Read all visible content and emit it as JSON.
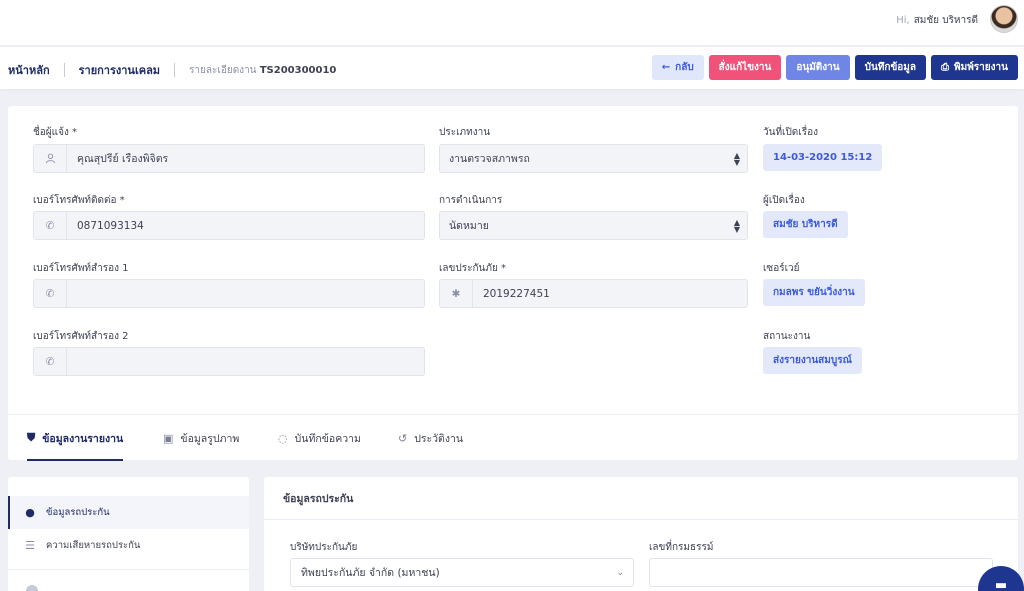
{
  "header": {
    "greeting_prefix": "Hi,",
    "user_name": "สมชัย บริหารดี"
  },
  "breadcrumb": {
    "home": "หน้าหลัก",
    "claims": "รายการงานเคลม",
    "detail_prefix": "รายละเอียดงาน",
    "job_id": "TS200300010"
  },
  "actions": {
    "back": "กลับ",
    "edit": "สั่งแก้ไขงาน",
    "approve": "อนุมัติงาน",
    "save": "บันทึกข้อมูล",
    "print": "พิมพ์รายงาน"
  },
  "form": {
    "reporter_label": "ชื่อผู้แจ้ง *",
    "reporter_value": "คุณสุปรีย์ เรืองพิจิตร",
    "phone_label": "เบอร์โทรศัพท์ติดต่อ *",
    "phone_value": "0871093134",
    "phone_alt1_label": "เบอร์โทรศัพท์สำรอง 1",
    "phone_alt1_value": "",
    "phone_alt2_label": "เบอร์โทรศัพท์สำรอง 2",
    "phone_alt2_value": "",
    "job_type_label": "ประเภทงาน",
    "job_type_value": "งานตรวจสภาพรถ",
    "process_label": "การดำเนินการ",
    "process_value": "นัดหมาย",
    "policy_label": "เลขประกันภัย *",
    "policy_value": "2019227451",
    "opened_date_label": "วันที่เปิดเรื่อง",
    "opened_date_value": "14-03-2020 15:12",
    "opened_by_label": "ผู้เปิดเรื่อง",
    "opened_by_value": "สมชัย บริหารดี",
    "surveyor_label": "เซอร์เวย์",
    "surveyor_value": "กมลพร ขยันวิ่งงาน",
    "status_label": "สถานะงาน",
    "status_value": "ส่งรายงานสมบูรณ์"
  },
  "tabs": [
    {
      "label": "ข้อมูลงานรายงาน",
      "icon": "shield-icon"
    },
    {
      "label": "ข้อมูลรูปภาพ",
      "icon": "image-icon"
    },
    {
      "label": "บันทึกข้อความ",
      "icon": "chat-icon"
    },
    {
      "label": "ประวัติงาน",
      "icon": "history-icon"
    }
  ],
  "sidebar": {
    "items": [
      {
        "label": "ข้อมูลรถประกัน",
        "icon": "user-icon"
      },
      {
        "label": "ความเสียหายรถประกัน",
        "icon": "list-icon"
      }
    ]
  },
  "vehicle": {
    "title": "ข้อมูลรถประกัน",
    "insurer_label": "บริษัทประกันภัย",
    "insurer_value": "ทิพยประกันภัย จำกัด (มหาชน)",
    "policy_no_label": "เลขที่กรมธรรม์",
    "policy_no_value": ""
  },
  "colors": {
    "primary": "#1f3690",
    "danger": "#f0527a",
    "accent": "#6f86e6",
    "badge_bg": "#e3e9fb"
  }
}
